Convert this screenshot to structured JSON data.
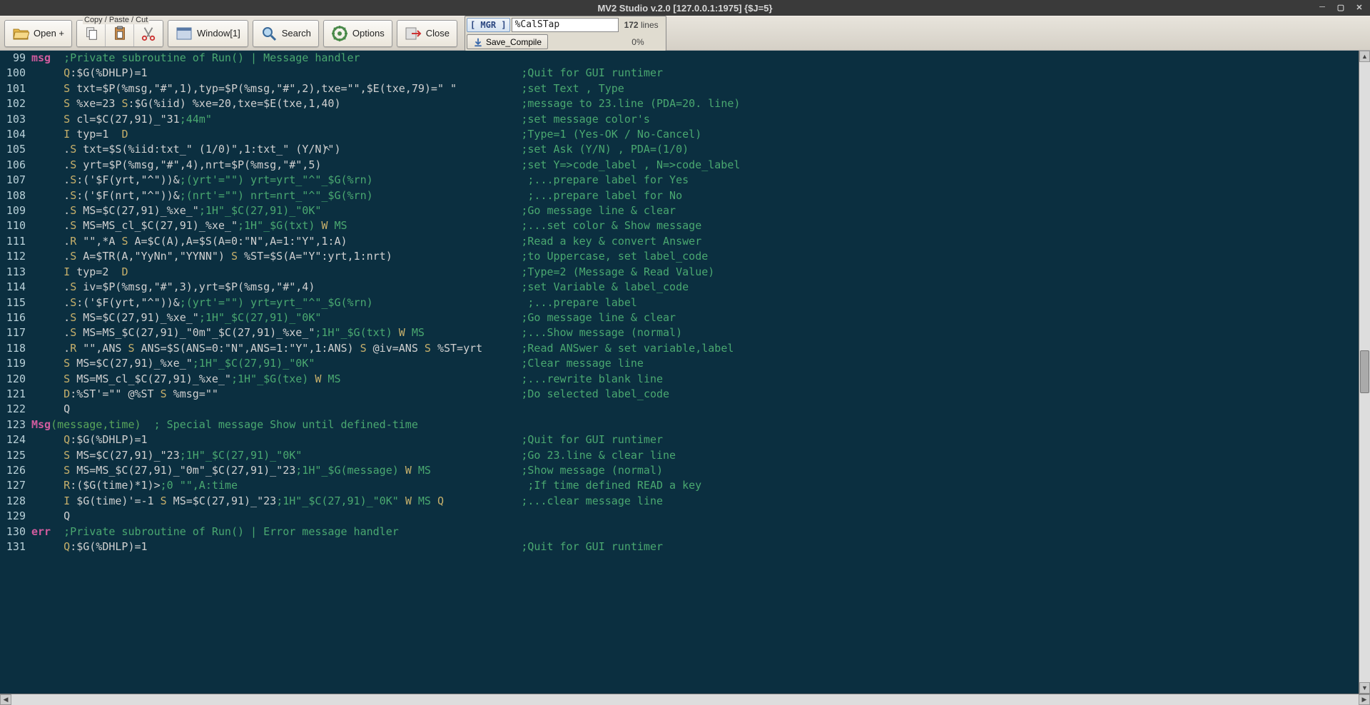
{
  "title": "MV2 Studio v.2.0 [127.0.0.1:1975]  {$J=5}",
  "toolbar": {
    "open": "Open +",
    "cpc_label": "Copy / Paste / Cut",
    "window": "Window[1]",
    "search": "Search",
    "options": "Options",
    "close": "Close"
  },
  "file": {
    "namespace": "[ MGR    ]",
    "routine": "%CalSTap",
    "lines": "172",
    "lines_label": "lines",
    "save": "Save_Compile",
    "progress": "0%"
  },
  "code": [
    {
      "n": 99,
      "label": "msg",
      "body": "  ;Private subroutine of Run() | Message handler"
    },
    {
      "n": 100,
      "body": "     Q:$G(%DHLP)=1                                                          ;Quit for GUI runtimer"
    },
    {
      "n": 101,
      "body": "     S txt=$P(%msg,\"#\",1),typ=$P(%msg,\"#\",2),txe=\"\",$E(txe,79)=\" \"          ;set Text , Type"
    },
    {
      "n": 102,
      "body": "     S %xe=23 S:$G(%iid) %xe=20,txe=$E(txe,1,40)                            ;message to 23.line (PDA=20. line)"
    },
    {
      "n": 103,
      "body": "     S cl=$C(27,91)_\"31;44m\"                                                ;set message color's"
    },
    {
      "n": 104,
      "body": "     I typ=1  D                                                             ;Type=1 (Yes-OK / No-Cancel)"
    },
    {
      "n": 105,
      "body": "     .S txt=$S(%iid:txt_\" (1/0)\",1:txt_\" (Y/N)\")                            ;set Ask (Y/N) , PDA=(1/0)"
    },
    {
      "n": 106,
      "body": "     .S yrt=$P(%msg,\"#\",4),nrt=$P(%msg,\"#\",5)                               ;set Y=>code_label , N=>code_label"
    },
    {
      "n": 107,
      "body": "     .S:('$F(yrt,\"^\"))&(yrt'=\"\") yrt=yrt_\"^\"_$G(%rn)                        ;...prepare label for Yes"
    },
    {
      "n": 108,
      "body": "     .S:('$F(nrt,\"^\"))&(nrt'=\"\") nrt=nrt_\"^\"_$G(%rn)                        ;...prepare label for No"
    },
    {
      "n": 109,
      "body": "     .S MS=$C(27,91)_%xe_\";1H\"_$C(27,91)_\"0K\"                               ;Go message line & clear"
    },
    {
      "n": 110,
      "body": "     .S MS=MS_cl_$C(27,91)_%xe_\";1H\"_$G(txt) W MS                           ;...set color & Show message"
    },
    {
      "n": 111,
      "body": "     .R \"\",*A S A=$C(A),A=$S(A=0:\"N\",A=1:\"Y\",1:A)                           ;Read a key & convert Answer"
    },
    {
      "n": 112,
      "body": "     .S A=$TR(A,\"YyNn\",\"YYNN\") S %ST=$S(A=\"Y\":yrt,1:nrt)                    ;to Uppercase, set label_code"
    },
    {
      "n": 113,
      "body": "     I typ=2  D                                                             ;Type=2 (Message & Read Value)"
    },
    {
      "n": 114,
      "body": "     .S iv=$P(%msg,\"#\",3),yrt=$P(%msg,\"#\",4)                                ;set Variable & label_code"
    },
    {
      "n": 115,
      "body": "     .S:('$F(yrt,\"^\"))&(yrt'=\"\") yrt=yrt_\"^\"_$G(%rn)                        ;...prepare label"
    },
    {
      "n": 116,
      "body": "     .S MS=$C(27,91)_%xe_\";1H\"_$C(27,91)_\"0K\"                               ;Go message line & clear"
    },
    {
      "n": 117,
      "body": "     .S MS=MS_$C(27,91)_\"0m\"_$C(27,91)_%xe_\";1H\"_$G(txt) W MS               ;...Show message (normal)"
    },
    {
      "n": 118,
      "body": "     .R \"\",ANS S ANS=$S(ANS=0:\"N\",ANS=1:\"Y\",1:ANS) S @iv=ANS S %ST=yrt      ;Read ANSwer & set variable,label"
    },
    {
      "n": 119,
      "body": "     S MS=$C(27,91)_%xe_\";1H\"_$C(27,91)_\"0K\"                                ;Clear message line"
    },
    {
      "n": 120,
      "body": "     S MS=MS_cl_$C(27,91)_%xe_\";1H\"_$G(txe) W MS                            ;...rewrite blank line"
    },
    {
      "n": 121,
      "body": "     D:%ST'=\"\" @%ST S %msg=\"\"                                               ;Do selected label_code"
    },
    {
      "n": 122,
      "body": "     Q"
    },
    {
      "n": 123,
      "label": "Msg",
      "param": "(message,time)",
      "body": "  ; Special message Show until defined-time"
    },
    {
      "n": 124,
      "body": "     Q:$G(%DHLP)=1                                                          ;Quit for GUI runtimer"
    },
    {
      "n": 125,
      "body": "     S MS=$C(27,91)_\"23;1H\"_$C(27,91)_\"0K\"                                  ;Go 23.line & clear line"
    },
    {
      "n": 126,
      "body": "     S MS=MS_$C(27,91)_\"0m\"_$C(27,91)_\"23;1H\"_$G(message) W MS              ;Show message (normal)"
    },
    {
      "n": 127,
      "body": "     R:($G(time)*1)>0 \"\",A:time                                             ;If time defined READ a key"
    },
    {
      "n": 128,
      "body": "     I $G(time)'=-1 S MS=$C(27,91)_\"23;1H\"_$C(27,91)_\"0K\" W MS Q            ;...clear message line"
    },
    {
      "n": 129,
      "body": "     Q"
    },
    {
      "n": 130,
      "label": "err",
      "body": "  ;Private subroutine of Run() | Error message handler"
    },
    {
      "n": 131,
      "body": "     Q:$G(%DHLP)=1                                                          ;Quit for GUI runtimer"
    }
  ]
}
